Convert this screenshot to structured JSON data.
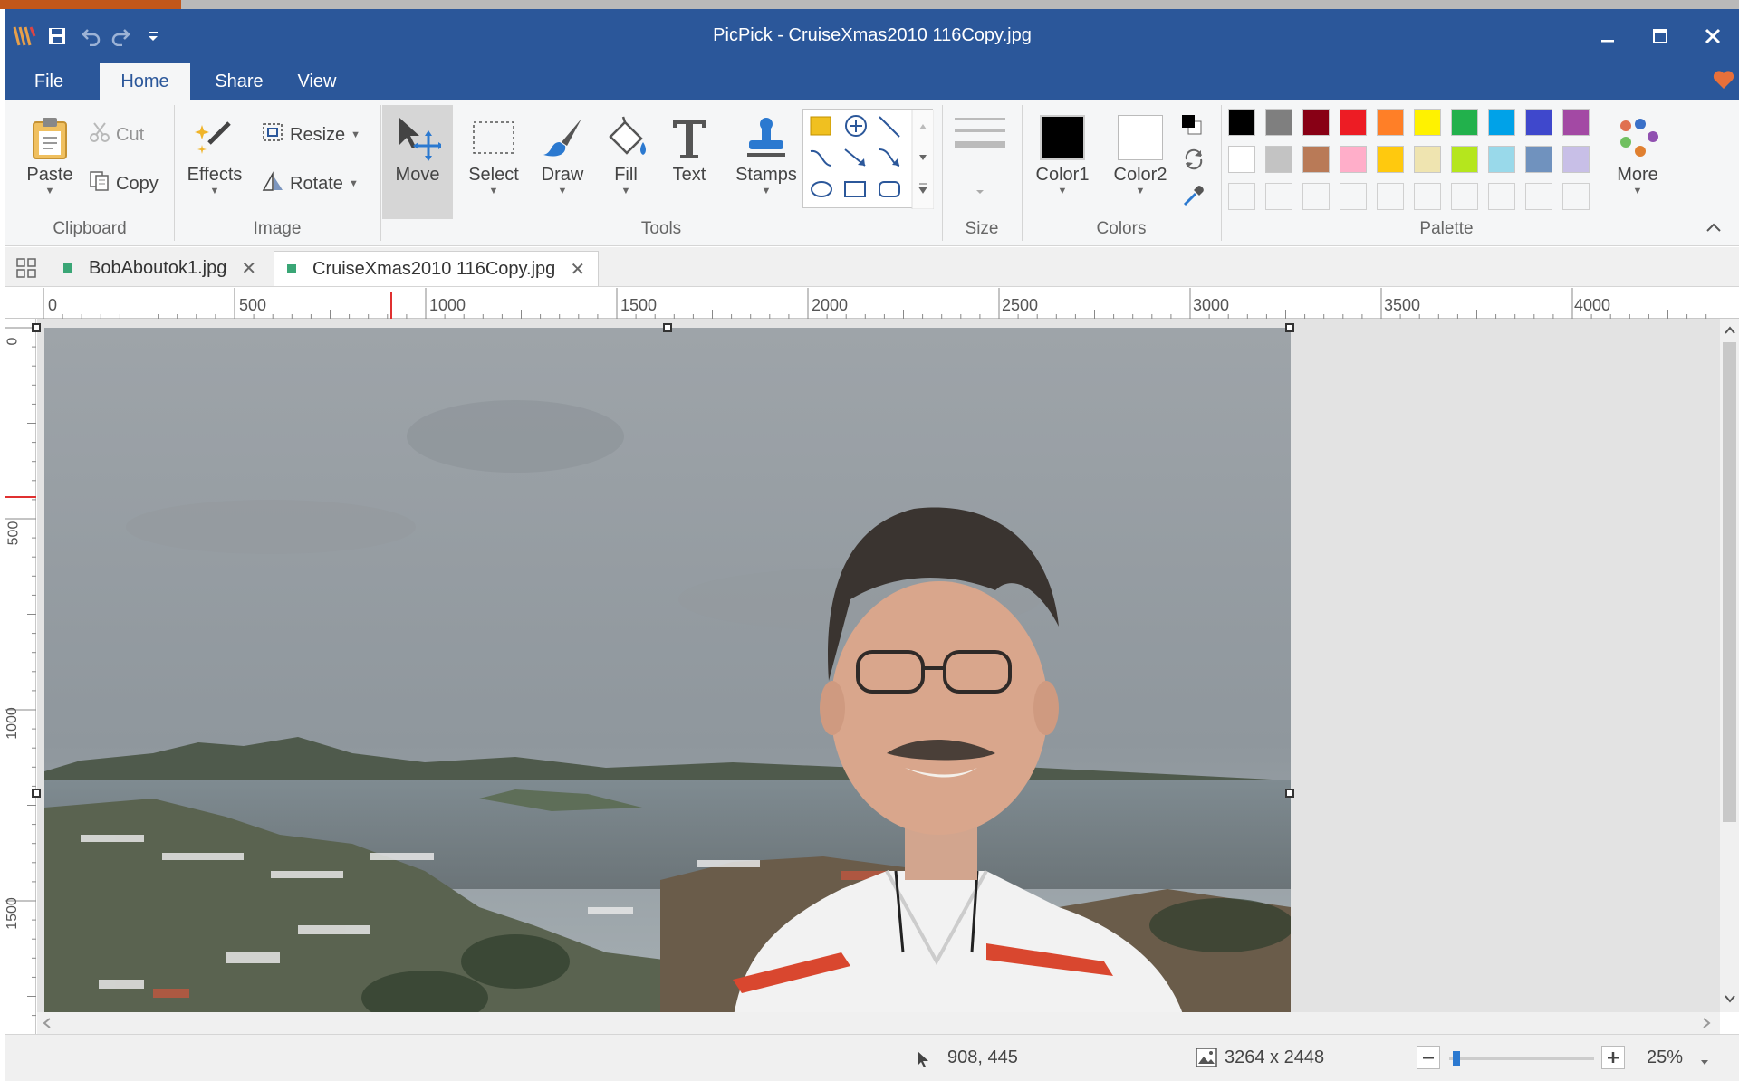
{
  "window": {
    "title": "PicPick - CruiseXmas2010 116Copy.jpg",
    "title_bar_color": "#2b579a"
  },
  "ribbon_tabs": [
    {
      "label": "File"
    },
    {
      "label": "Home",
      "active": true
    },
    {
      "label": "Share"
    },
    {
      "label": "View"
    }
  ],
  "clipboard": {
    "paste": "Paste",
    "cut": "Cut",
    "copy": "Copy",
    "group": "Clipboard"
  },
  "image": {
    "effects": "Effects",
    "resize": "Resize",
    "rotate": "Rotate",
    "group": "Image"
  },
  "tools": {
    "move": "Move",
    "select": "Select",
    "draw": "Draw",
    "fill": "Fill",
    "text": "Text",
    "stamps": "Stamps",
    "group": "Tools"
  },
  "size": {
    "group": "Size"
  },
  "colors": {
    "color1": "Color1",
    "color2": "Color2",
    "group": "Colors",
    "color1_value": "#000000",
    "color2_value": "#ffffff"
  },
  "palette": {
    "group": "Palette",
    "more": "More",
    "row1": [
      "#000000",
      "#7f7f7f",
      "#880015",
      "#ed1c24",
      "#ff7f27",
      "#fff200",
      "#22b14c",
      "#00a2e8",
      "#3f48cc",
      "#a349a4"
    ],
    "row2": [
      "#ffffff",
      "#c3c3c3",
      "#b97a57",
      "#ffaec9",
      "#ffc90e",
      "#efe4b0",
      "#b5e61d",
      "#99d9ea",
      "#7092be",
      "#c8bfe7"
    ]
  },
  "document_tabs": [
    {
      "name": "BobAboutok1.jpg"
    },
    {
      "name": "CruiseXmas2010 116Copy.jpg",
      "active": true
    }
  ],
  "ruler": {
    "h_labels": [
      "0",
      "500",
      "1000",
      "1500",
      "2000",
      "2500",
      "3000",
      "3500",
      "4000"
    ],
    "v_labels": [
      "0",
      "500",
      "1000",
      "1500"
    ]
  },
  "status": {
    "cursor_pos": "908, 445",
    "image_size": "3264 x 2448",
    "zoom": "25%",
    "zoom_fraction": 0.25
  }
}
